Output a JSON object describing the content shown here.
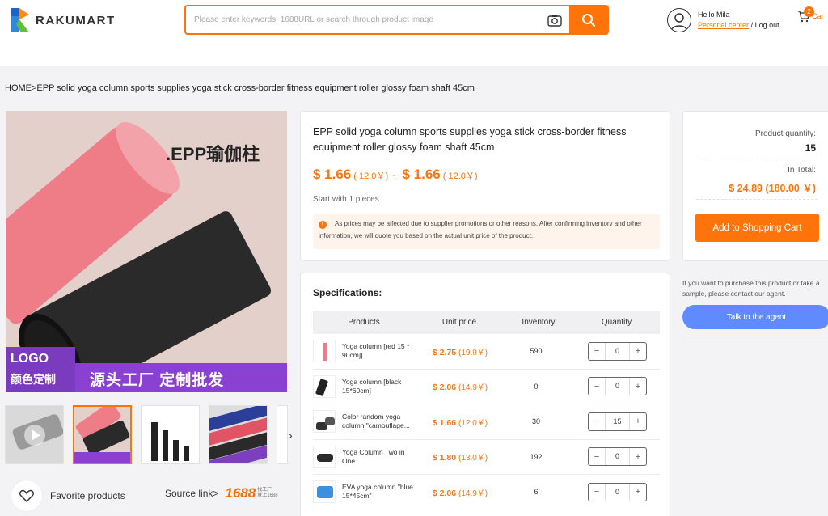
{
  "header": {
    "brand": "RAKUMART",
    "search_placeholder": "Please enter keywords, 1688URL or search through product image",
    "greeting": "Hello Mila",
    "personal_center": "Personal center",
    "separator": "/",
    "logout": "Log out",
    "cart_count": "2",
    "cart_label": "Car"
  },
  "breadcrumb": "HOME>EPP solid yoga column sports supplies yoga stick cross-border fitness equipment roller glossy foam shaft 45cm",
  "gallery": {
    "main_overlay_title": ".EPP瑜伽柱",
    "main_logo_text": "LOGO",
    "main_logo_sub": "颜色定制",
    "main_banner": "源头工厂 定制批发",
    "thumb_arrow": "›"
  },
  "favorite": {
    "label": "Favorite products"
  },
  "source": {
    "label": "Source link>",
    "brand": "1688",
    "brand_sub1": "找工厂",
    "brand_sub2": "就上1688"
  },
  "product": {
    "title": "EPP solid yoga column sports supplies yoga stick cross-border fitness equipment roller glossy foam shaft 45cm",
    "price_low": "$ 1.66",
    "price_low_cny": "( 12.0￥)",
    "price_sep": "~",
    "price_high": "$ 1.66",
    "price_high_cny": "( 12.0￥)",
    "start_with": "Start with 1 pieces",
    "notice_icon": "!",
    "notice": "As prices may be affected due to supplier promotions or other reasons. After confirming inventory and other information, we will quote you based on the actual unit price of the product."
  },
  "specs": {
    "title": "Specifications:",
    "headers": [
      "Products",
      "Unit price",
      "Inventory",
      "Quantity"
    ],
    "rows": [
      {
        "name": "Yoga column [red 15 * 90cm]]",
        "price": "$ 2.75",
        "cny": "(19.9￥)",
        "inventory": "590",
        "qty": "0",
        "color": "#f07a86"
      },
      {
        "name": "Yoga column [black 15*60cm]",
        "price": "$ 2.06",
        "cny": "(14.9￥)",
        "inventory": "0",
        "qty": "0",
        "color": "#222222"
      },
      {
        "name": "Color random yoga column \"camouflage...",
        "price": "$ 1.66",
        "cny": "(12.0￥)",
        "inventory": "30",
        "qty": "15",
        "color": "#333333"
      },
      {
        "name": "Yoga Column Two in One",
        "price": "$ 1.80",
        "cny": "(13.0￥)",
        "inventory": "192",
        "qty": "0",
        "color": "#2b2b2b"
      },
      {
        "name": "EVA yoga column \"blue 15*45cm\"",
        "price": "$ 2.06",
        "cny": "(14.9￥)",
        "inventory": "6",
        "qty": "0",
        "color": "#3d8fe0"
      }
    ],
    "minus": "−",
    "plus": "+"
  },
  "summary": {
    "qty_label": "Product quantity:",
    "qty_value": "15",
    "total_label": "In Total:",
    "total_value": "$ 24.89 (180.00 ￥)",
    "add_cart": "Add to Shopping Cart"
  },
  "agent": {
    "text": "If you want to purchase this product or take a sample, please contact our agent.",
    "button": "Talk to the agent"
  },
  "colors": {
    "accent": "#ff730b",
    "agent": "#608bff"
  }
}
